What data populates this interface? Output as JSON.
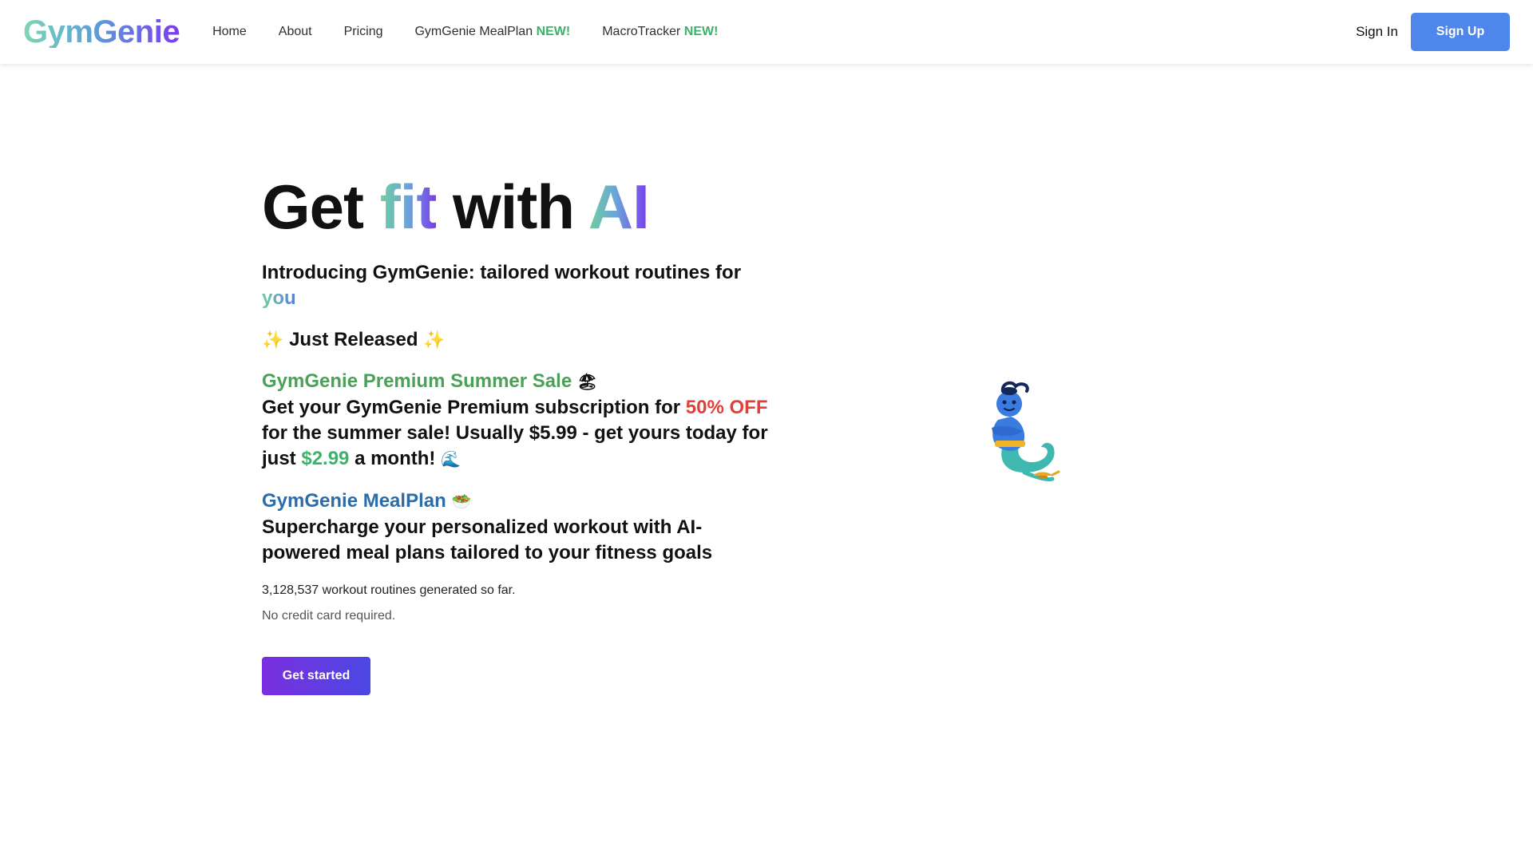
{
  "brand": {
    "logo": "GymGenie"
  },
  "nav": {
    "links": [
      {
        "label": "Home"
      },
      {
        "label": "About"
      },
      {
        "label": "Pricing"
      },
      {
        "label": "GymGenie MealPlan",
        "badge": "NEW!"
      },
      {
        "label": "MacroTracker",
        "badge": "NEW!"
      }
    ],
    "sign_in": "Sign In",
    "sign_up": "Sign Up"
  },
  "hero": {
    "title_get": "Get",
    "title_fit": "fit",
    "title_with": "with",
    "title_ai": "AI",
    "subtitle": "Introducing GymGenie: tailored workout routines for",
    "subtitle_highlight": "you",
    "just_released": "Just Released",
    "sparkle_icon": "✨"
  },
  "promos": {
    "summer": {
      "title": "GymGenie Premium Summer Sale",
      "icon": "🏖",
      "text_1": "Get your GymGenie Premium subscription for",
      "discount": "50% OFF",
      "text_2": "for the summer sale! Usually $5.99 - get yours today for just",
      "price": "$2.99",
      "text_3": "a month!",
      "icon_2": "🌊"
    },
    "mealplan": {
      "title": "GymGenie MealPlan",
      "icon": "🥗",
      "text": "Supercharge your personalized workout with AI-powered meal plans tailored to your fitness goals"
    }
  },
  "stats": {
    "routines": "3,128,537 workout routines generated so far.",
    "note": "No credit card required."
  },
  "cta": {
    "label": "Get started"
  },
  "colors": {
    "primary_blue": "#4f86ec",
    "cta_purple": "#7b2ee0",
    "new_green": "#3bb36b",
    "promo_green": "#4ca05a",
    "promo_blue": "#2d6ca7",
    "discount_red": "#e0403a"
  },
  "illustration": {
    "icon": "genie-icon"
  }
}
